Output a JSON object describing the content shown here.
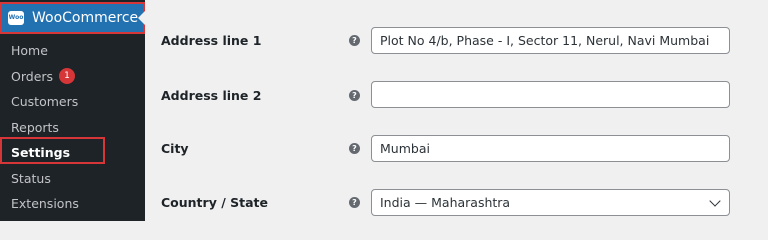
{
  "sidebar": {
    "brand": "WooCommerce",
    "logo_text": "Woo",
    "items": [
      {
        "label": "Home"
      },
      {
        "label": "Orders",
        "badge": "1"
      },
      {
        "label": "Customers"
      },
      {
        "label": "Reports"
      },
      {
        "label": "Settings"
      },
      {
        "label": "Status"
      },
      {
        "label": "Extensions"
      }
    ]
  },
  "form": {
    "address_line_1": {
      "label": "Address line 1",
      "value": "Plot No 4/b, Phase - I, Sector 11, Nerul, Navi Mumbai"
    },
    "address_line_2": {
      "label": "Address line 2",
      "value": ""
    },
    "city": {
      "label": "City",
      "value": "Mumbai"
    },
    "country_state": {
      "label": "Country / State",
      "value": "India — Maharashtra"
    },
    "help_glyph": "?"
  },
  "colors": {
    "sidebar_bg": "#1d2327",
    "accent": "#2271b1",
    "highlight": "#d63638"
  }
}
